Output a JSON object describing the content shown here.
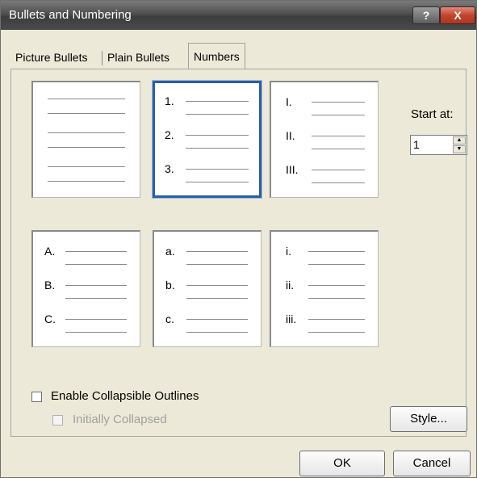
{
  "window": {
    "title": "Bullets and Numbering",
    "help_glyph": "?",
    "close_glyph": "X"
  },
  "tabs": [
    {
      "label": "Picture Bullets"
    },
    {
      "label": "Plain Bullets"
    },
    {
      "label": "Numbers",
      "active": true
    }
  ],
  "numbering_styles": [
    {
      "markers": [
        "",
        "",
        ""
      ]
    },
    {
      "markers": [
        "1.",
        "2.",
        "3."
      ],
      "selected": true
    },
    {
      "markers": [
        "I.",
        "II.",
        "III."
      ]
    },
    {
      "markers": [
        "A.",
        "B.",
        "C."
      ]
    },
    {
      "markers": [
        "a.",
        "b.",
        "c."
      ]
    },
    {
      "markers": [
        "i.",
        "ii.",
        "iii."
      ]
    }
  ],
  "start_at": {
    "label": "Start at:",
    "value": "1"
  },
  "options": {
    "enable_collapsible": {
      "label": "Enable Collapsible Outlines",
      "checked": false
    },
    "initially_collapsed": {
      "label": "Initially Collapsed",
      "checked": false,
      "disabled": true
    }
  },
  "buttons": {
    "style": "Style...",
    "ok": "OK",
    "cancel": "Cancel"
  },
  "colors": {
    "selection_border": "#2a5ea8",
    "title_bar": "#4f4f4f",
    "close_button": "#c3442b"
  }
}
